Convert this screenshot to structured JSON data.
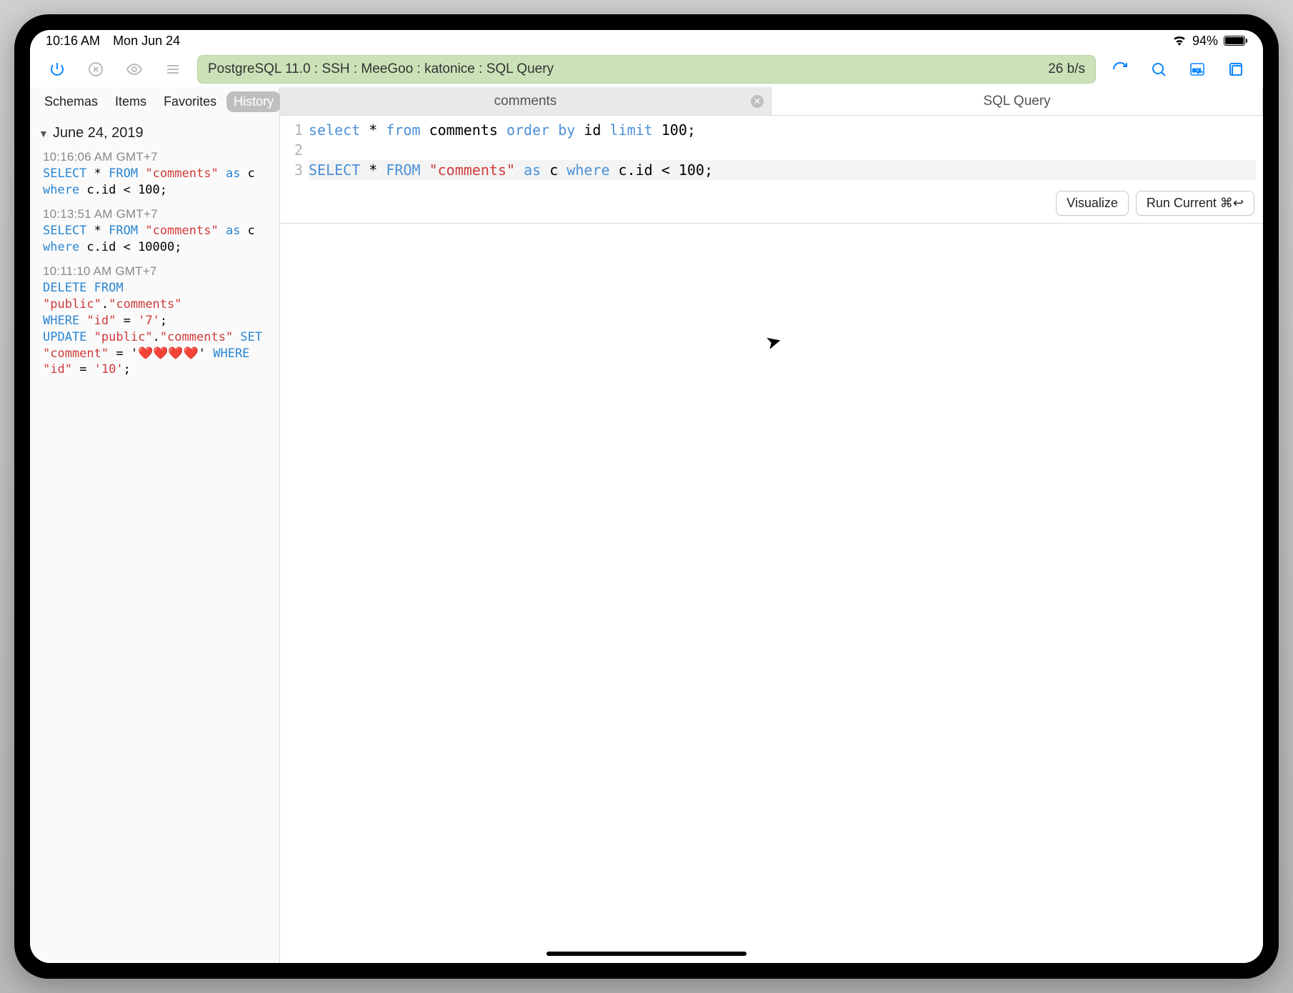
{
  "statusbar": {
    "time": "10:16 AM",
    "date": "Mon Jun 24",
    "battery_pct": "94%"
  },
  "toolbar": {
    "connection_label": "PostgreSQL 11.0 : SSH : MeeGoo : katonice : SQL Query",
    "throughput": "26 b/s"
  },
  "sidebar": {
    "tabs": {
      "schemas": "Schemas",
      "items": "Items",
      "favorites": "Favorites",
      "history": "History"
    },
    "group_date": "June 24, 2019",
    "history": [
      {
        "time": "10:16:06 AM GMT+7",
        "tokens": [
          {
            "t": "SELECT",
            "c": "kw"
          },
          {
            "t": " * ",
            "c": ""
          },
          {
            "t": "FROM",
            "c": "kw"
          },
          {
            "t": " ",
            "c": ""
          },
          {
            "t": "\"comments\"",
            "c": "str"
          },
          {
            "t": " ",
            "c": ""
          },
          {
            "t": "as",
            "c": "kw"
          },
          {
            "t": " c ",
            "c": ""
          },
          {
            "t": "\n",
            "c": ""
          },
          {
            "t": "where",
            "c": "kw"
          },
          {
            "t": " c.id < 100;",
            "c": ""
          }
        ]
      },
      {
        "time": "10:13:51 AM GMT+7",
        "tokens": [
          {
            "t": "SELECT",
            "c": "kw"
          },
          {
            "t": " * ",
            "c": ""
          },
          {
            "t": "FROM",
            "c": "kw"
          },
          {
            "t": " ",
            "c": ""
          },
          {
            "t": "\"comments\"",
            "c": "str"
          },
          {
            "t": " ",
            "c": ""
          },
          {
            "t": "as",
            "c": "kw"
          },
          {
            "t": " c ",
            "c": ""
          },
          {
            "t": "\n",
            "c": ""
          },
          {
            "t": "where",
            "c": "kw"
          },
          {
            "t": " c.id < 10000;",
            "c": ""
          }
        ]
      },
      {
        "time": "10:11:10 AM GMT+7",
        "tokens": [
          {
            "t": "DELETE",
            "c": "kw"
          },
          {
            "t": " ",
            "c": ""
          },
          {
            "t": "FROM",
            "c": "kw"
          },
          {
            "t": " ",
            "c": ""
          },
          {
            "t": "\"public\"",
            "c": "str"
          },
          {
            "t": ".",
            "c": ""
          },
          {
            "t": "\"comments\"",
            "c": "str"
          },
          {
            "t": " ",
            "c": ""
          },
          {
            "t": "\n",
            "c": ""
          },
          {
            "t": "WHERE",
            "c": "kw"
          },
          {
            "t": " ",
            "c": ""
          },
          {
            "t": "\"id\"",
            "c": "str"
          },
          {
            "t": " = ",
            "c": ""
          },
          {
            "t": "'7'",
            "c": "str"
          },
          {
            "t": "; ",
            "c": ""
          },
          {
            "t": "\n",
            "c": ""
          },
          {
            "t": "UPDATE",
            "c": "kw"
          },
          {
            "t": " ",
            "c": ""
          },
          {
            "t": "\"public\"",
            "c": "str"
          },
          {
            "t": ".",
            "c": ""
          },
          {
            "t": "\"comments\"",
            "c": "str"
          },
          {
            "t": " ",
            "c": ""
          },
          {
            "t": "SET",
            "c": "kw"
          },
          {
            "t": " ",
            "c": ""
          },
          {
            "t": "\n",
            "c": ""
          },
          {
            "t": "\"comment\"",
            "c": "str"
          },
          {
            "t": " = '",
            "c": ""
          },
          {
            "t": "❤️❤️❤️❤️",
            "c": "heart"
          },
          {
            "t": "' ",
            "c": ""
          },
          {
            "t": "WHERE",
            "c": "kw"
          },
          {
            "t": " ",
            "c": ""
          },
          {
            "t": "\n",
            "c": ""
          },
          {
            "t": "\"id\"",
            "c": "str"
          },
          {
            "t": " = ",
            "c": ""
          },
          {
            "t": "'10'",
            "c": "str"
          },
          {
            "t": ";",
            "c": ""
          }
        ]
      }
    ]
  },
  "editor": {
    "tabs": {
      "comments": "comments",
      "sqlquery": "SQL Query"
    },
    "lines": [
      [
        {
          "t": "select",
          "c": "kw2"
        },
        {
          "t": " * ",
          "c": "ident"
        },
        {
          "t": "from",
          "c": "kw2"
        },
        {
          "t": " comments ",
          "c": "ident"
        },
        {
          "t": "order",
          "c": "kw2"
        },
        {
          "t": " ",
          "c": ""
        },
        {
          "t": "by",
          "c": "kw2"
        },
        {
          "t": " id ",
          "c": "ident"
        },
        {
          "t": "limit",
          "c": "kw2"
        },
        {
          "t": " 100;",
          "c": "ident"
        }
      ],
      [
        {
          "t": "",
          "c": ""
        }
      ],
      [
        {
          "t": "SELECT",
          "c": "kw2"
        },
        {
          "t": " * ",
          "c": "ident"
        },
        {
          "t": "FROM",
          "c": "kw2"
        },
        {
          "t": " ",
          "c": ""
        },
        {
          "t": "\"comments\"",
          "c": "str"
        },
        {
          "t": " ",
          "c": ""
        },
        {
          "t": "as",
          "c": "kw2"
        },
        {
          "t": " c ",
          "c": "ident"
        },
        {
          "t": "where",
          "c": "kw2"
        },
        {
          "t": " c.id < 100;",
          "c": "ident"
        }
      ]
    ],
    "buttons": {
      "visualize": "Visualize",
      "run": "Run Current ⌘↩︎"
    }
  }
}
